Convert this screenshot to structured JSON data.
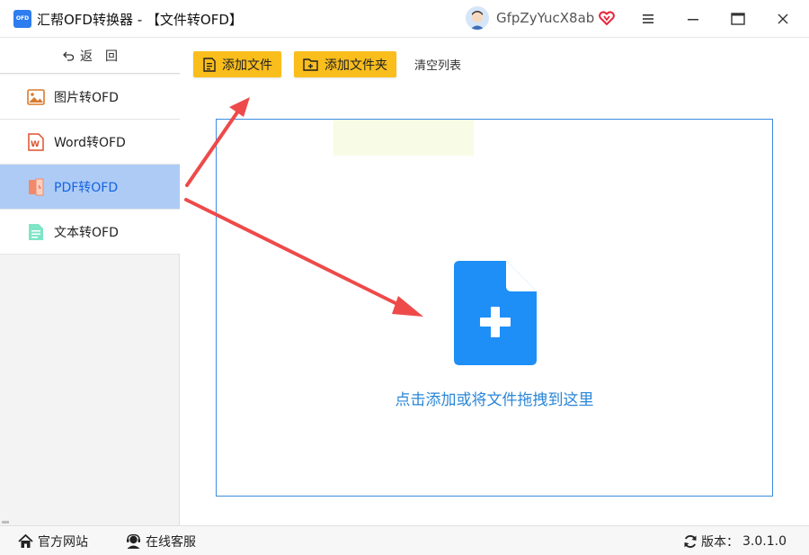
{
  "window": {
    "logo_text": "OFD",
    "title": "汇帮OFD转换器 - 【文件转OFD】",
    "user_name": "GfpZyYucX8ab"
  },
  "sidebar": {
    "back_label": "返回",
    "items": [
      {
        "label": "图片转OFD",
        "icon": "image-icon",
        "active": false
      },
      {
        "label": "Word转OFD",
        "icon": "word-icon",
        "active": false
      },
      {
        "label": "PDF转OFD",
        "icon": "pdf-icon",
        "active": true
      },
      {
        "label": "文本转OFD",
        "icon": "text-file-icon",
        "active": false
      }
    ]
  },
  "toolbar": {
    "add_file_label": "添加文件",
    "add_folder_label": "添加文件夹",
    "clear_list_label": "清空列表"
  },
  "drop_zone": {
    "hint": "点击添加或将文件拖拽到这里"
  },
  "footer": {
    "website_label": "官方网站",
    "support_label": "在线客服",
    "version_prefix": "版本：",
    "version": "3.0.1.0"
  },
  "colors": {
    "accent_blue": "#1e8ff7",
    "button_yellow": "#f9bd1c",
    "active_nav_bg": "#aecbf6",
    "arrow_red": "#ee4a4a"
  }
}
